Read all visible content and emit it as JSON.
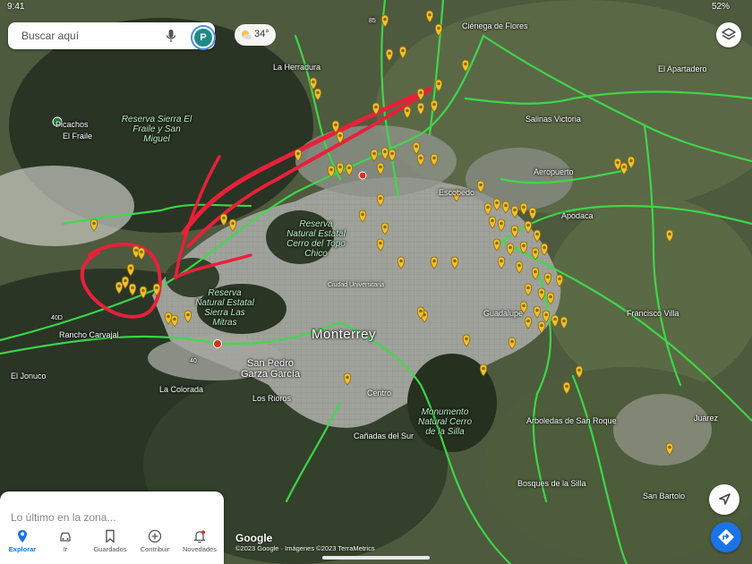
{
  "status_bar": {
    "time": "9:41",
    "battery": "52%"
  },
  "search": {
    "placeholder": "Buscar aquí",
    "avatar_letter": "P"
  },
  "weather": {
    "temperature": "34°"
  },
  "map": {
    "city": "Monterrey",
    "places": [
      "Picachos",
      "El Fraile",
      "La Herradura",
      "Ciénega de Flores",
      "El Apartadero",
      "Salinas Victoria",
      "Aeropuerto",
      "Escobedo",
      "Apodaca",
      "Guadalupe",
      "San Pedro Garza García",
      "La Colorada",
      "Los Rioros",
      "Cañadas del Sur",
      "Arboledas de San Roque",
      "Bosques de la Silla",
      "San Bartolo",
      "Juárez",
      "Francisco Villa",
      "Rancho Carvajal",
      "El Jonuco",
      "Ciudad Universitaria",
      "Centro"
    ],
    "parks": [
      "Reserva Sierra El Fraile y San Miguel",
      "Reserva Natural Estatal Cerro del Topo Chico",
      "Reserva Natural Estatal Sierra Las Mitras",
      "Monumento Natural Cerro de la Silla"
    ],
    "route_numbers": [
      "40D",
      "40",
      "85"
    ]
  },
  "bottom_panel": {
    "latest_label": "Lo último en la zona..."
  },
  "tabs": [
    {
      "label": "Explorar",
      "icon": "pin-icon",
      "active": true
    },
    {
      "label": "Ir",
      "icon": "car-icon",
      "active": false
    },
    {
      "label": "Guardados",
      "icon": "bookmark-icon",
      "active": false
    },
    {
      "label": "Contribuir",
      "icon": "plus-circle-icon",
      "active": false
    },
    {
      "label": "Novedades",
      "icon": "bell-icon",
      "active": false
    }
  ],
  "attribution": {
    "logo": "Google",
    "text": "©2023 Google · Imágenes ©2023 TerraMetrics"
  },
  "colors": {
    "accent": "#1a73e8",
    "road": "#3ddc4a",
    "annotation": "#e8203a",
    "marker": "#f2c12e"
  }
}
